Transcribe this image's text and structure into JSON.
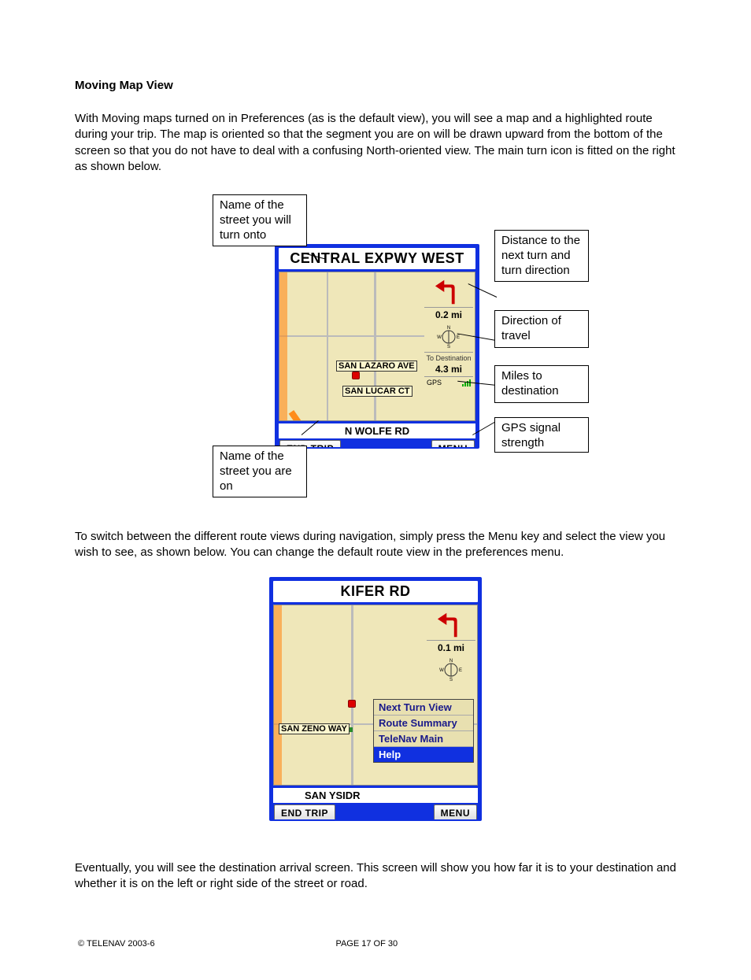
{
  "section_title": "Moving Map View",
  "para1": "With Moving maps turned on in Preferences (as is the default view), you will see a map and a highlighted route during your trip.  The map is oriented so that the segment you are on will be drawn upward from the bottom of the screen so that you do not have to deal with a confusing North-oriented view.  The main turn icon is fitted on the right as shown below.",
  "para2": "To switch between the different route views during navigation, simply press the Menu key and select the view you wish to see, as shown below.   You can change the default route view in the preferences menu.",
  "para3": "Eventually, you will see the destination arrival screen.  This screen will show you how far it is to your destination and whether it is on the left or right side of the street or road.",
  "callouts": {
    "turn_street": "Name of the street you will turn onto",
    "next_turn": "Distance to the next turn and turn direction",
    "direction": "Direction of travel",
    "miles_dest": "Miles to destination",
    "gps": "GPS signal strength",
    "current_street": "Name of the street you are on"
  },
  "fig1": {
    "banner": "CENTRAL EXPWY WEST",
    "turn_distance": "0.2 mi",
    "to_dest_label": "To Destination",
    "to_dest_value": "4.3 mi",
    "gps_label": "GPS",
    "street_label_1": "SAN LAZARO AVE",
    "street_label_2": "SAN LUCAR CT",
    "current_road": "N WOLFE RD",
    "btn_left": "END TRIP",
    "btn_right": "MENU"
  },
  "fig2": {
    "banner": "KIFER RD",
    "turn_distance": "0.1 mi",
    "street_label_1": "SAN ZENO WAY",
    "current_road": "SAN YSIDR",
    "btn_left": "END TRIP",
    "btn_right": "MENU",
    "menu": {
      "item1": "Next Turn View",
      "item2": "Route Summary",
      "item3": "TeleNav Main",
      "item4": "Help"
    }
  },
  "footer": {
    "copyright": "© TELENAV 2003-6",
    "page": "PAGE 17 OF 30"
  },
  "compass": {
    "n": "N",
    "s": "S",
    "e": "E",
    "w": "W"
  }
}
